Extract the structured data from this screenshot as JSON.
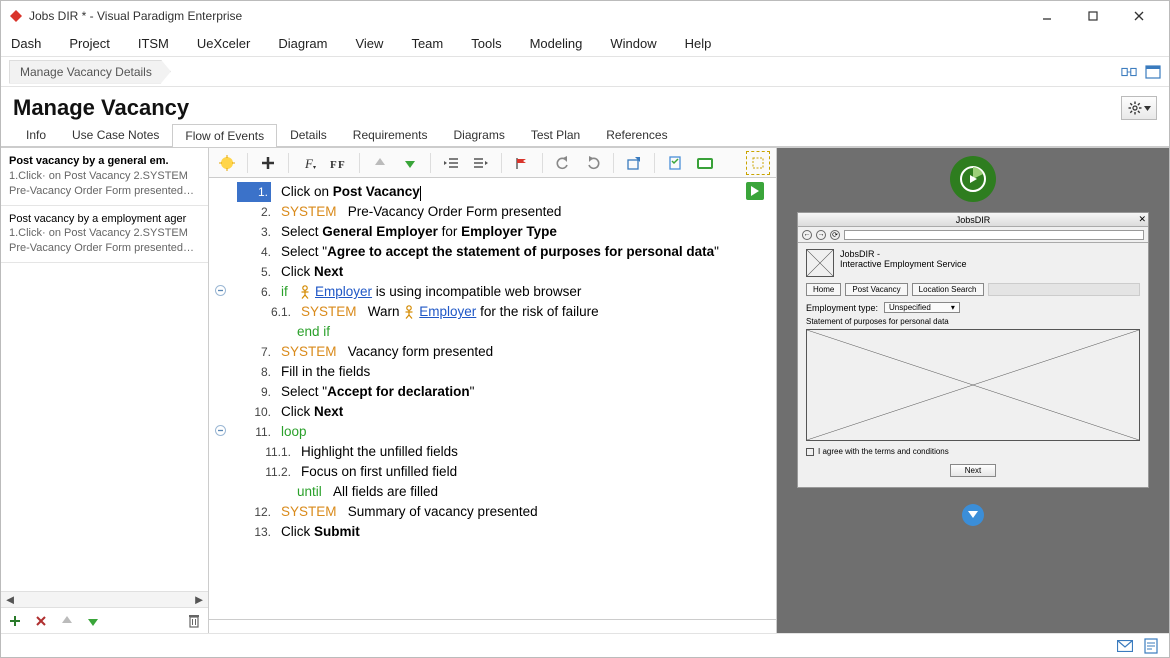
{
  "window": {
    "title": "Jobs DIR * - Visual Paradigm Enterprise"
  },
  "menu": [
    "Dash",
    "Project",
    "ITSM",
    "UeXceler",
    "Diagram",
    "View",
    "Team",
    "Tools",
    "Modeling",
    "Window",
    "Help"
  ],
  "breadcrumb": {
    "label": "Manage Vacancy Details"
  },
  "page": {
    "title": "Manage Vacancy"
  },
  "tabs": [
    "Info",
    "Use Case Notes",
    "Flow of Events",
    "Details",
    "Requirements",
    "Diagrams",
    "Test Plan",
    "References"
  ],
  "active_tab": 2,
  "scenarios": [
    {
      "title": "Post vacancy by a general em.",
      "l2": "1.Click· on Post Vacancy 2.SYSTEM",
      "l3": "Pre-Vacancy Order Form presented…"
    },
    {
      "title": "Post vacancy by a employment ager",
      "l2": "1.Click· on Post Vacancy 2.SYSTEM",
      "l3": "Pre-Vacancy Order Form presented…"
    }
  ],
  "steps": [
    {
      "n": "1.",
      "type": "current",
      "html": "Click on <b>Post Vacancy</b>"
    },
    {
      "n": "2.",
      "html": "<span class='kw-sys'>SYSTEM</span>&nbsp;&nbsp;&nbsp;Pre-Vacancy Order Form presented"
    },
    {
      "n": "3.",
      "html": "Select <b>General Employer</b> for <b>Employer Type</b>"
    },
    {
      "n": "4.",
      "html": "Select \"<b>Agree to accept the statement of purposes for personal data</b>\""
    },
    {
      "n": "5.",
      "html": "Click <b>Next</b>"
    },
    {
      "n": "6.",
      "marg": "collapse",
      "html": "<span class='kw-ctrl'>if</span>&nbsp;&nbsp;&nbsp;<span class='actor-ico'><svg width='12' height='14' viewBox='0 0 12 14'><circle cx='6' cy='3' r='2.2' fill='none' stroke='#d48a00' stroke-width='1.2'/><line x1='6' y1='5.2' x2='6' y2='10' stroke='#d48a00' stroke-width='1.2'/><line x1='2.5' y1='7' x2='9.5' y2='7' stroke='#d48a00' stroke-width='1.2'/><line x1='6' y1='10' x2='3' y2='13.5' stroke='#d48a00' stroke-width='1.2'/><line x1='6' y1='10' x2='9' y2='13.5' stroke='#d48a00' stroke-width='1.2'/></svg></span><span class='link'>Employer</span> is using incompatible web browser"
    },
    {
      "n": "6.1.",
      "sub": true,
      "html": "<span class='kw-sys'>SYSTEM</span>&nbsp;&nbsp;&nbsp;Warn <span class='actor-ico'><svg width='12' height='14' viewBox='0 0 12 14'><circle cx='6' cy='3' r='2.2' fill='none' stroke='#d48a00' stroke-width='1.2'/><line x1='6' y1='5.2' x2='6' y2='10' stroke='#d48a00' stroke-width='1.2'/><line x1='2.5' y1='7' x2='9.5' y2='7' stroke='#d48a00' stroke-width='1.2'/><line x1='6' y1='10' x2='3' y2='13.5' stroke='#d48a00' stroke-width='1.2'/><line x1='6' y1='10' x2='9' y2='13.5' stroke='#d48a00' stroke-width='1.2'/></svg></span><span class='link'>Employer</span> for the risk of failure"
    },
    {
      "n": "",
      "endif": true,
      "html": "<span class='kw-ctrl'>end if</span>"
    },
    {
      "n": "7.",
      "html": "<span class='kw-sys'>SYSTEM</span>&nbsp;&nbsp;&nbsp;Vacancy form presented"
    },
    {
      "n": "8.",
      "html": "Fill in the fields"
    },
    {
      "n": "9.",
      "html": "Select \"<b>Accept for declaration</b>\""
    },
    {
      "n": "10.",
      "html": "Click <b>Next</b>"
    },
    {
      "n": "11.",
      "marg": "collapse",
      "html": "<span class='kw-ctrl'>loop</span>"
    },
    {
      "n": "11.1.",
      "sub": true,
      "html": "Highlight the unfilled fields"
    },
    {
      "n": "11.2.",
      "sub": true,
      "html": "Focus on first unfilled field"
    },
    {
      "n": "",
      "until": true,
      "html": "<span class='kw-ctrl'>until</span>&nbsp;&nbsp;&nbsp;All fields are filled"
    },
    {
      "n": "12.",
      "html": "<span class='kw-sys'>SYSTEM</span>&nbsp;&nbsp;&nbsp;Summary of vacancy presented"
    },
    {
      "n": "13.",
      "html": "Click <b>Submit</b>"
    }
  ],
  "wireframe": {
    "title": "JobsDIR",
    "brand_line1": "JobsDIR -",
    "brand_line2": "Interactive Employment Service",
    "buttons": [
      "Home",
      "Post Vacancy",
      "Location Search"
    ],
    "field_label": "Employment type:",
    "field_value": "Unspecified",
    "statement": "Statement of purposes for personal data",
    "checkbox": "I agree with the terms and conditions",
    "next": "Next"
  }
}
